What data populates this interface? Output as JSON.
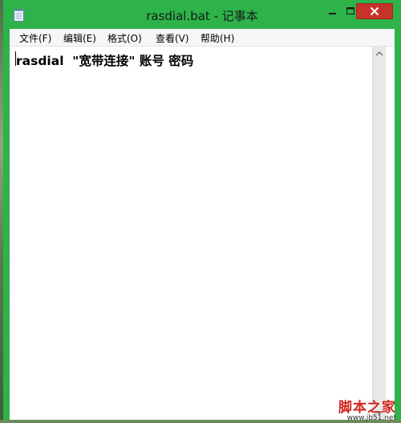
{
  "window": {
    "title": "rasdial.bat - 记事本",
    "frame_color": "#2db34a",
    "close_color": "#c7332b"
  },
  "icons": {
    "app": "notepad-icon",
    "minimize": "minimize-icon",
    "maximize": "maximize-icon",
    "close": "close-icon",
    "scroll_up": "chevron-up-icon",
    "scroll_down": "chevron-down-icon"
  },
  "menu": {
    "items": [
      {
        "label": "文件(F)"
      },
      {
        "label": "编辑(E)"
      },
      {
        "label": "格式(O)"
      },
      {
        "label": "查看(V)"
      },
      {
        "label": "帮助(H)"
      }
    ]
  },
  "editor": {
    "content": "rasdial  \"宽带连接\" 账号 密码"
  },
  "watermark": {
    "text": "脚本之家",
    "url": "www.jb51.net"
  }
}
